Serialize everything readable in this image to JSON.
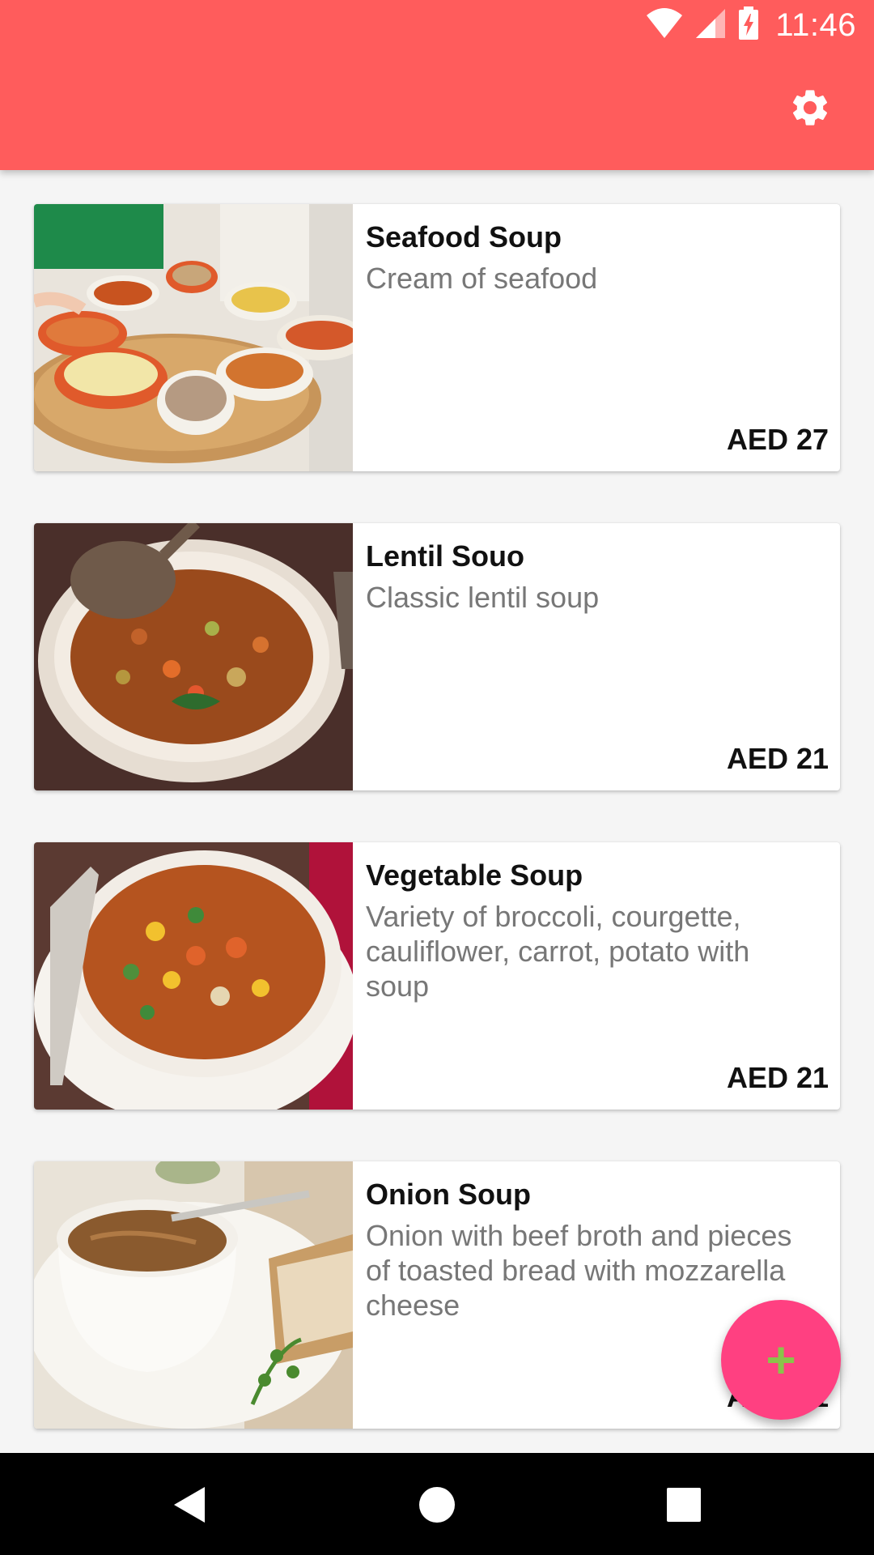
{
  "status_bar": {
    "time": "11:46"
  },
  "app_bar": {
    "settings_icon": "gear-icon",
    "color": "#ff5c5c"
  },
  "items": [
    {
      "title": "Seafood Soup",
      "description": "Cream of seafood",
      "price": "AED 27"
    },
    {
      "title": "Lentil Souo",
      "description": "Classic lentil soup",
      "price": "AED 21"
    },
    {
      "title": "Vegetable Soup",
      "description": "Variety of broccoli, courgette, cauliflower, carrot, potato with soup",
      "price": "AED 21"
    },
    {
      "title": "Onion Soup",
      "description": "Onion with beef broth and pieces of toasted bread with mozzarella cheese",
      "price": "AED 21"
    }
  ],
  "fab": {
    "icon": "plus-icon",
    "label": "+",
    "color": "#ff4081"
  },
  "nav_bar": {
    "back_icon": "back-icon",
    "home_icon": "home-icon",
    "recents_icon": "recents-icon"
  }
}
